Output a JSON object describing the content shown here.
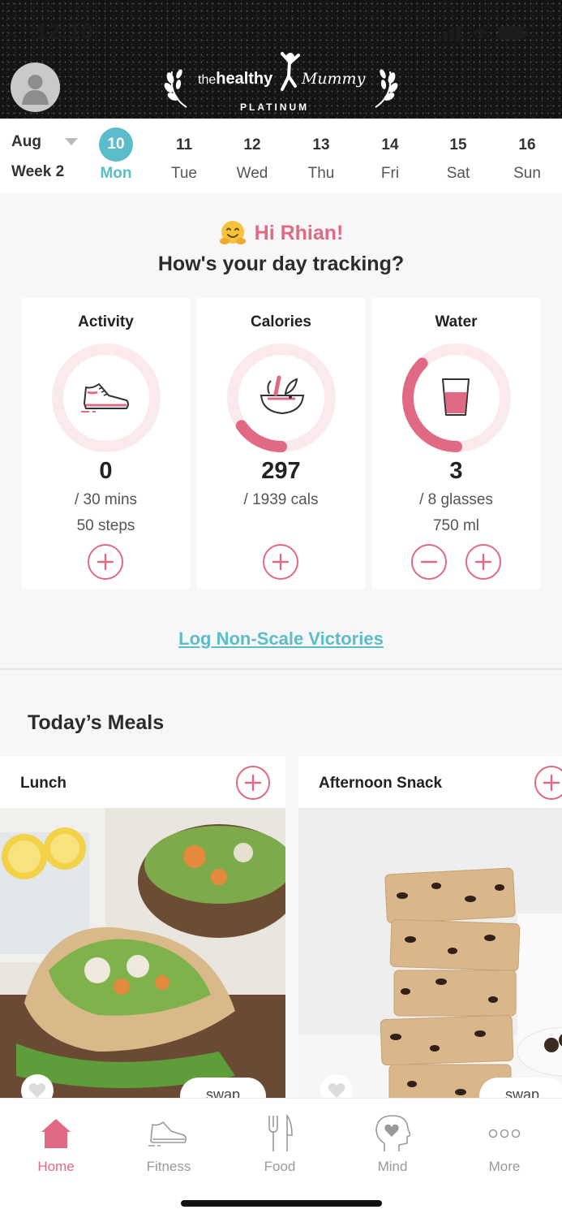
{
  "status_bar": {
    "time": "12:10"
  },
  "header": {
    "logo_the": "the",
    "logo_healthy": "healthy",
    "logo_mummy": "Mummy",
    "logo_sub": "PLATINUM"
  },
  "calendar": {
    "month": "Aug",
    "week": "Week 2",
    "days": [
      {
        "num": "10",
        "name": "Mon",
        "active": true
      },
      {
        "num": "11",
        "name": "Tue"
      },
      {
        "num": "12",
        "name": "Wed"
      },
      {
        "num": "13",
        "name": "Thu"
      },
      {
        "num": "14",
        "name": "Fri"
      },
      {
        "num": "15",
        "name": "Sat"
      },
      {
        "num": "16",
        "name": "Sun"
      }
    ]
  },
  "greeting": {
    "hello": "Hi Rhian!",
    "question": "How's your day tracking?"
  },
  "trackers": {
    "activity": {
      "title": "Activity",
      "value": "0",
      "goal": "/ 30 mins",
      "extra": "50 steps",
      "progress": 0
    },
    "calories": {
      "title": "Calories",
      "value": "297",
      "goal": "/ 1939 cals",
      "progress": 0.153
    },
    "water": {
      "title": "Water",
      "value": "3",
      "goal": "/ 8 glasses",
      "extra": "750 ml",
      "progress": 0.375
    }
  },
  "log_link": "Log Non-Scale Victories",
  "meals": {
    "title": "Today’s Meals",
    "items": [
      {
        "name": "Lunch",
        "swap": "swap"
      },
      {
        "name": "Afternoon Snack",
        "swap": "swap"
      }
    ]
  },
  "tabs": [
    {
      "label": "Home",
      "icon": "home-icon",
      "active": true
    },
    {
      "label": "Fitness",
      "icon": "shoe-icon"
    },
    {
      "label": "Food",
      "icon": "fork-knife-icon"
    },
    {
      "label": "Mind",
      "icon": "head-heart-icon"
    },
    {
      "label": "More",
      "icon": "more-dots-icon"
    }
  ],
  "colors": {
    "accent_pink": "#e06a83",
    "accent_teal": "#5bbccc",
    "ring_bg": "#fbeaec"
  }
}
